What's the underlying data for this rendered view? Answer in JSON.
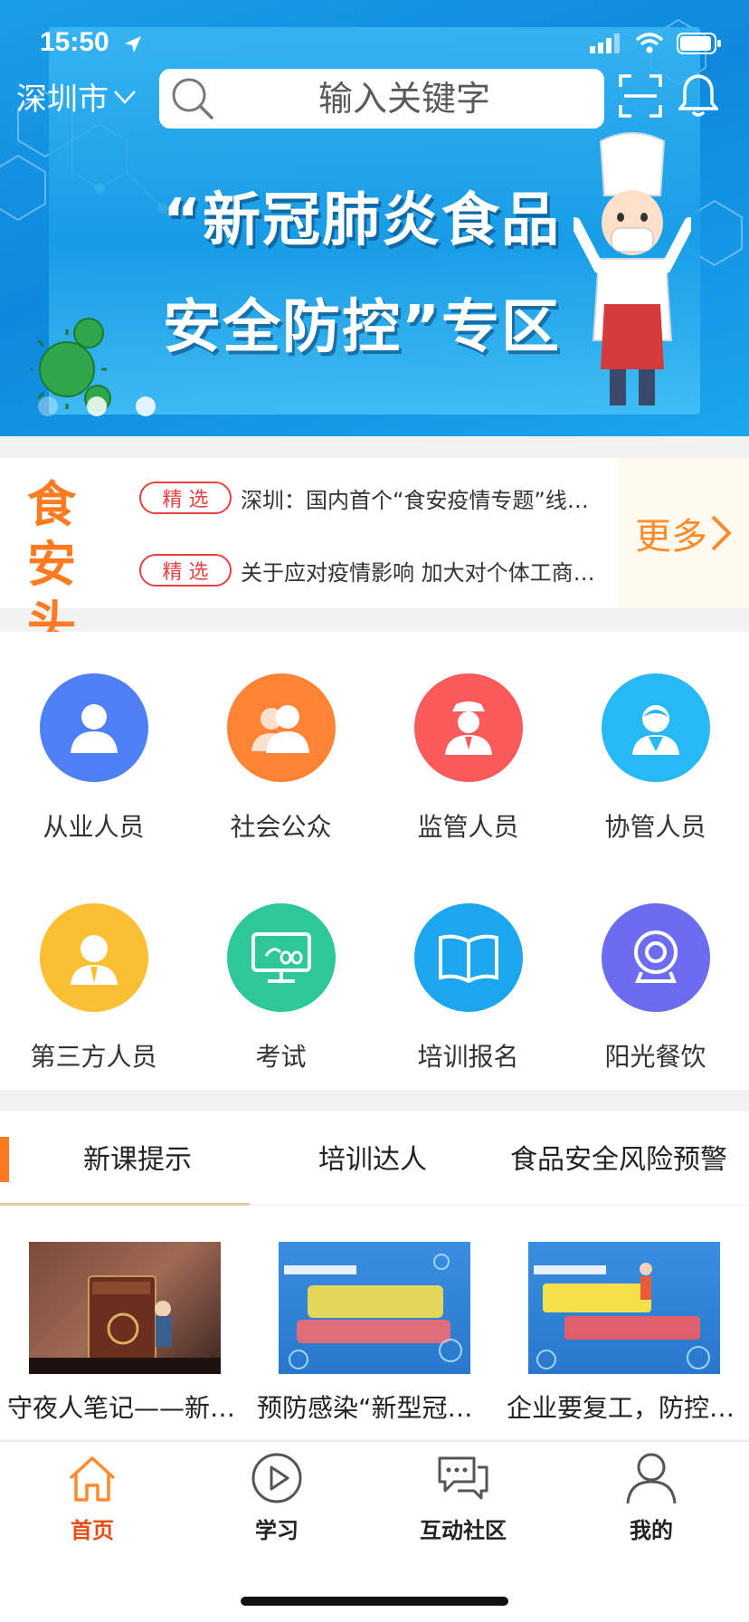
{
  "status_bar": {
    "time": "15:50"
  },
  "header": {
    "city": "深圳市",
    "search_placeholder": "输入关键字"
  },
  "banner": {
    "line1": "“新冠肺炎食品",
    "line2": "安全防控”专区",
    "slide_count": 3,
    "active_slide": 1
  },
  "headlines": {
    "logo_line1": "食安",
    "logo_line2": "头条",
    "items": [
      {
        "tag": "精 选",
        "text": "深圳：国内首个“食安疫情专题”线上课堂上线"
      },
      {
        "tag": "精 选",
        "text": "关于应对疫情影响 加大对个体工商户扶持力度"
      }
    ],
    "more_label": "更多"
  },
  "grid": {
    "items": [
      {
        "label": "从业人员",
        "icon": "person-icon",
        "color": "#4f7ff5"
      },
      {
        "label": "社会公众",
        "icon": "group-icon",
        "color": "#ff8335"
      },
      {
        "label": "监管人员",
        "icon": "officer-icon",
        "color": "#fa5a5a"
      },
      {
        "label": "协管人员",
        "icon": "assistant-icon",
        "color": "#27b9f5"
      },
      {
        "label": "第三方人员",
        "icon": "third-party-icon",
        "color": "#fbbf33"
      },
      {
        "label": "考试",
        "icon": "exam-screen-icon",
        "color": "#2ec79a"
      },
      {
        "label": "培训报名",
        "icon": "book-icon",
        "color": "#1ca6f0"
      },
      {
        "label": "阳光餐饮",
        "icon": "camera-icon",
        "color": "#6c6cf0"
      }
    ]
  },
  "course_tabs": {
    "tabs": [
      "新课提示",
      "培训达人",
      "食品安全风险预警"
    ],
    "active": 0
  },
  "courses": [
    {
      "title": "守夜人笔记——新型冠状病毒"
    },
    {
      "title": "预防感染“新型冠状病毒”有妙招"
    },
    {
      "title": "企业要复工，防控指引要分明"
    }
  ],
  "bottom_nav": {
    "items": [
      {
        "label": "首页",
        "icon": "home-icon",
        "active": true
      },
      {
        "label": "学习",
        "icon": "play-icon",
        "active": false
      },
      {
        "label": "互动社区",
        "icon": "chat-icon",
        "active": false
      },
      {
        "label": "我的",
        "icon": "profile-icon",
        "active": false
      }
    ],
    "active_color": "#e94b16"
  }
}
